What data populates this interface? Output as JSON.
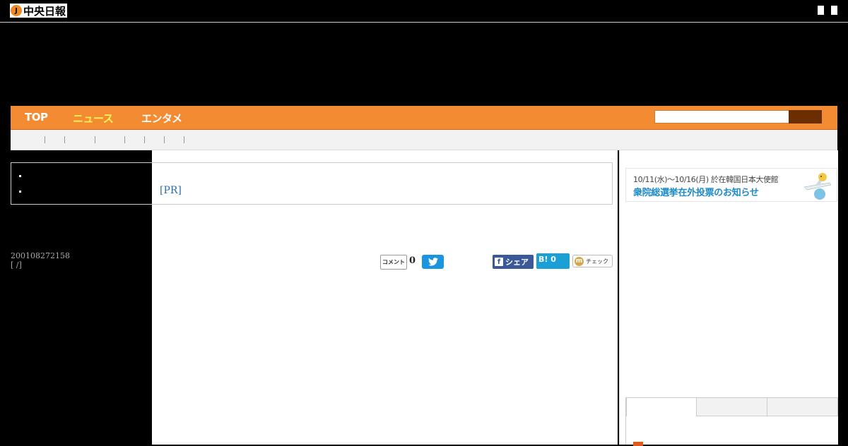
{
  "header": {
    "logo_text": "中央日報",
    "logo_badge": "J"
  },
  "nav": {
    "items": [
      {
        "label": "TOP",
        "active": false
      },
      {
        "label": "ニュース",
        "active": true
      },
      {
        "label": "エンタメ",
        "active": false
      }
    ],
    "search": {
      "value": "",
      "placeholder": ""
    }
  },
  "article": {
    "pr_label": "[PR]",
    "id_line": "200108272158",
    "meta_line": "[ /]"
  },
  "share": {
    "comment_label": "コメント",
    "comment_count": "0",
    "facebook_label": "シェア",
    "hatena_label": "B! 0",
    "mixi_label": "チェック"
  },
  "banner": {
    "line1": "10/11(水)～10/16(月) 於在韓国日本大使館",
    "line2": "衆院総選挙在外投票のお知らせ"
  },
  "colors": {
    "nav_orange": "#f28b31",
    "nav_active": "#fff35a",
    "link_blue": "#2a6ea8",
    "twitter": "#1b95e0",
    "facebook": "#3b5998",
    "hatena": "#1a9fd6"
  }
}
